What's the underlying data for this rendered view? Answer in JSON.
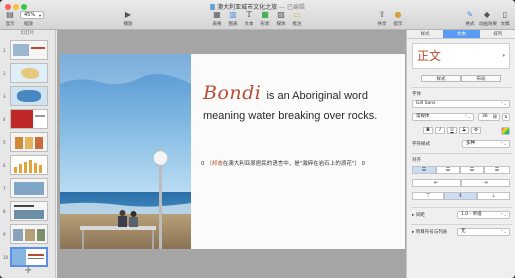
{
  "window": {
    "title": "澳大利亚城市文化之旅",
    "status": "— 已编辑"
  },
  "toolbar": {
    "zoom_value": "45%",
    "view_label": "显示",
    "zoom_label": "缩放",
    "play_label": "播放",
    "table_label": "表格",
    "chart_label": "图表",
    "text_label": "文本",
    "shape_label": "形状",
    "media_label": "媒体",
    "comment_label": "批注",
    "share_label": "共享",
    "tips_label": "提示",
    "format_label": "格式",
    "animate_label": "动画效果",
    "document_label": "文稿"
  },
  "sidebar": {
    "header": "幻灯片",
    "slides": [
      {
        "num": "1"
      },
      {
        "num": "2"
      },
      {
        "num": "3"
      },
      {
        "num": "4"
      },
      {
        "num": "5"
      },
      {
        "num": "6"
      },
      {
        "num": "7"
      },
      {
        "num": "8"
      },
      {
        "num": "9"
      },
      {
        "num": "10"
      }
    ],
    "add_label": "+"
  },
  "slide": {
    "word": "Bondi",
    "line1_rest": "is an Aboriginal word",
    "line2": "meaning water breaking over rocks.",
    "caption_num_left": "0",
    "caption_open": "（",
    "caption_word": "邦迪",
    "caption_rest": "在澳大利亚原居民的语言中，是\"激碎在岩石上的浪花\"）",
    "caption_num_right": "0"
  },
  "inspector": {
    "tabs": [
      "样式",
      "文本",
      "排列"
    ],
    "active_tab": "文本",
    "paragraph_style": "正文",
    "seg_style": "样式",
    "seg_layout": "布局",
    "font_header": "字体",
    "font_family": "Gill Sans",
    "font_weight": "常规体",
    "font_size": "36",
    "font_size_unit": "磅",
    "char_style_label": "字符样式",
    "char_style_value": "多种",
    "alignment_header": "对齐",
    "spacing_label": "间距",
    "spacing_value": "1.0 - 单倍",
    "bullets_label": "项目符号与列表",
    "bullets_value": "无",
    "bold": "B",
    "italic": "I",
    "underline": "U",
    "strike": "S"
  },
  "colors": {
    "accent": "#5a9cf3",
    "title_red": "#b84d33"
  }
}
